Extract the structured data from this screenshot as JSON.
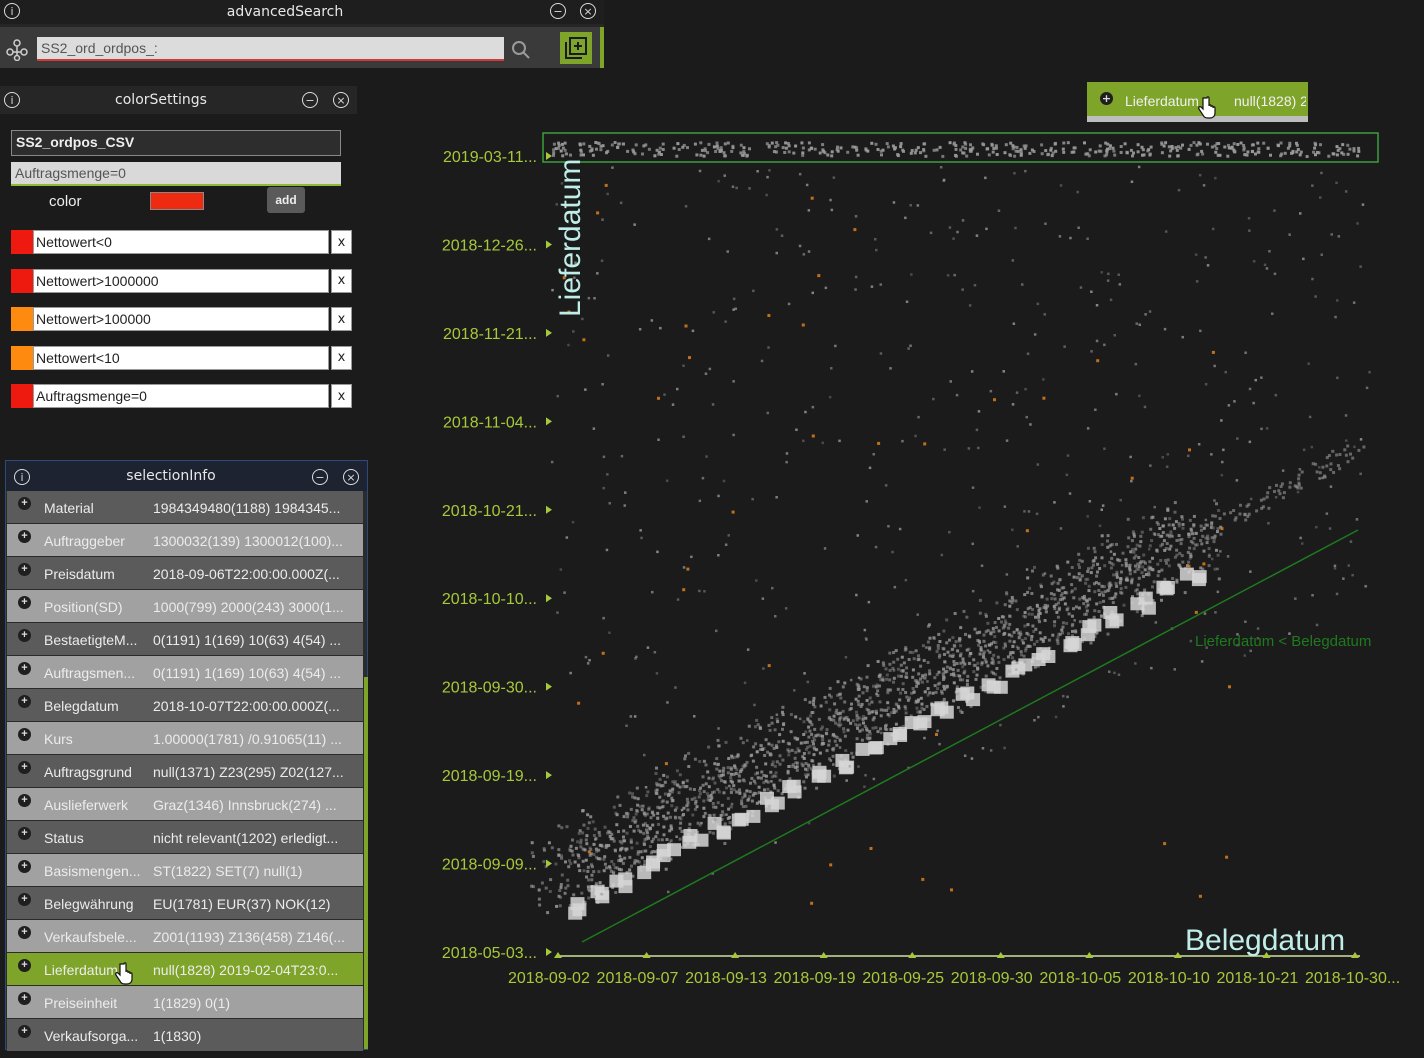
{
  "advanced_search": {
    "title": "advancedSearch",
    "query": "SS2_ord_ordpos_:"
  },
  "color_settings": {
    "title": "colorSettings",
    "dataset": "SS2_ordpos_CSV",
    "new_rule": "Auftragsmenge=0",
    "color_label": "color",
    "new_color": "#ee2a10",
    "add_label": "add",
    "remove_label": "x",
    "rules": [
      {
        "expr": "Nettowert<0",
        "color": "#ee1a10"
      },
      {
        "expr": "Nettowert>1000000",
        "color": "#ee1a10"
      },
      {
        "expr": "Nettowert>100000",
        "color": "#ff8a10"
      },
      {
        "expr": "Nettowert<10",
        "color": "#ff8a10"
      },
      {
        "expr": "Auftragsmenge=0",
        "color": "#ee1a10"
      }
    ]
  },
  "selection_info": {
    "title": "selectionInfo",
    "rows": [
      {
        "name": "Material",
        "value": "1984349480(1188) 1984345..."
      },
      {
        "name": "Auftraggeber",
        "value": "1300032(139) 1300012(100)..."
      },
      {
        "name": "Preisdatum",
        "value": "2018-09-06T22:00:00.000Z(..."
      },
      {
        "name": "Position(SD)",
        "value": "1000(799) 2000(243) 3000(1..."
      },
      {
        "name": "BestaetigteM...",
        "value": "0(1191) 1(169) 10(63) 4(54) ..."
      },
      {
        "name": "Auftragsmen...",
        "value": "0(1191) 1(169) 10(63) 4(54) ..."
      },
      {
        "name": "Belegdatum",
        "value": "2018-10-07T22:00:00.000Z(..."
      },
      {
        "name": "Kurs",
        "value": "1.00000(1781) /0.91065(11) ..."
      },
      {
        "name": "Auftragsgrund",
        "value": "null(1371) Z23(295) Z02(127..."
      },
      {
        "name": "Auslieferwerk",
        "value": "Graz(1346) Innsbruck(274) ..."
      },
      {
        "name": "Status",
        "value": "nicht relevant(1202) erledigt..."
      },
      {
        "name": "Basismengen...",
        "value": "ST(1822) SET(7) null(1)"
      },
      {
        "name": "Belegwährung",
        "value": "EU(1781) EUR(37) NOK(12)"
      },
      {
        "name": "Verkaufsbele...",
        "value": "Z001(1193) Z136(458) Z146(..."
      },
      {
        "name": "Lieferdatum",
        "value": "null(1828) 2019-02-04T23:0..."
      },
      {
        "name": "Preiseinheit",
        "value": "1(1829) 0(1)"
      },
      {
        "name": "Verkaufsorga...",
        "value": "1(1830)"
      }
    ],
    "selected_index": 14
  },
  "tooltip": {
    "name": "Lieferdatum",
    "value": "null(1828) 2"
  },
  "chart_data": {
    "type": "scatter",
    "xlabel": "Belegdatum",
    "ylabel": "Lieferdatum",
    "x_ticks": [
      "2018-09-02",
      "2018-09-07",
      "2018-09-13",
      "2018-09-19",
      "2018-09-25",
      "2018-09-30",
      "2018-10-05",
      "2018-10-10",
      "2018-10-21",
      "2018-10-30..."
    ],
    "y_ticks": [
      "2018-05-03...",
      "2018-09-09...",
      "2018-09-19...",
      "2018-09-30...",
      "2018-10-10...",
      "2018-10-21...",
      "2018-11-04...",
      "2018-11-21...",
      "2018-12-26...",
      "2019-03-11..."
    ],
    "reference_line_label": "Lieferdatum < Belegdatum",
    "point_color": "#9a9a9a",
    "highlight_color": "#d07a1c",
    "axis_color": "#a6c93a",
    "reference_line_color": "#1e7a1e",
    "selection_color": "#3aa03a"
  }
}
